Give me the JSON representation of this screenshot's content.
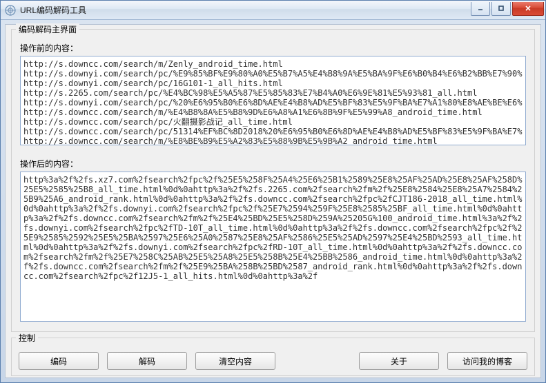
{
  "window": {
    "title": "URL编码解码工具"
  },
  "main_group": {
    "legend": "编码解码主界面",
    "before_label": "操作前的内容：",
    "after_label": "操作后的内容：",
    "before_text": "http://s.downcc.com/search/m/Zenly_android_time.html\nhttp://s.downyi.com/search/pc/%E9%85%BF%E9%80%A0%E5%B7%A5%E4%B8%9A%E5%BA%9F%E6%B0%B4%E6%B2%BB%E7%90% ...\nhttp://s.downyi.com/search/pc/16G101-1_all_hits.html\nhttp://s.2265.com/search/pc/%E4%BC%98%E5%A5%87%E5%85%83%E7%B4%A0%E6%9E%81%E5%93%81_all.html\nhttp://s.downyi.com/search/pc/%20%E6%95%B0%E6%8D%AE%E4%B8%AD%E5%BF%83%E5%9F%BA%E7%A1%80%E8%AE%BE%E6% ...\nhttp://s.downcc.com/search/m/%E4%B8%8A%E5%B8%9D%E6%A8%A1%E6%8B%9F%E5%99%A8_android_time.html\nhttp://s.downcc.com/search/pc/火翻摄影战记_all_time.html\nhttp://s.downcc.com/search/pc/51314%EF%BC%8D2018%20%E6%95%B0%E6%8D%AE%E4%B8%AD%E5%BF%83%E5%9F%BA%E7% ...\nhttp://s.downcc.com/search/m/%E8%BE%B9%E5%A2%83%E5%88%9B%E5%9B%A2_android_time.html",
    "after_text": "http%3a%2f%2fs.xz7.com%2fsearch%2fpc%2f%25E5%258F%25A4%25E6%25B1%2589%25E8%25AF%25AD%25E8%25AF%258D%25E5%2585%25B8_all_time.html%0d%0ahttp%3a%2f%2fs.2265.com%2fsearch%2fm%2f%25E8%2584%25E8%25A7%2584%25B9%25A6_android_rank.html%0d%0ahttp%3a%2f%2fs.downcc.com%2fsearch%2fpc%2fCJT186-2018_all_time.html%0d%0ahttp%3a%2f%2fs.downyi.com%2fsearch%2fpc%2f%25E7%2594%259F%25E8%2585%25BF_all_time.html%0d%0ahttp%3a%2f%2fs.downcc.com%2fsearch%2fm%2f%25E4%25BD%25E5%258D%259A%25205G%100_android_time.html%3a%2f%2fs.downyi.com%2fsearch%2fpc%2fTD-10T_all_time.html%0d%0ahttp%3a%2f%2fs.downcc.com%2fsearch%2fpc%2f%25E9%2585%2592%25E5%25BA%2597%25E6%25A0%2587%25E8%25AF%2586%25E5%25AD%2597%25E4%25BD%2593_all_time.html%0d%0ahttp%3a%2f%2fs.downyi.com%2fsearch%2fpc%2fRD-10T_all_time.html%0d%0ahttp%3a%2f%2fs.downcc.com%2fsearch%2fm%2f%25E7%258C%25AB%25E5%25A8%25E5%258B%25E4%25BB%2586_android_time.html%0d%0ahttp%3a%2f%2fs.downcc.com%2fsearch%2fm%2f%25E9%25BA%258B%25BD%2587_android_rank.html%0d%0ahttp%3a%2f%2fs.downcc.com%2fsearch%2fpc%2f12J5-1_all_hits.html%0d%0ahttp%3a%2f"
  },
  "control_group": {
    "legend": "控制",
    "buttons": {
      "encode": "编码",
      "decode": "解码",
      "clear": "清空内容",
      "about": "关于",
      "blog": "访问我的博客"
    }
  }
}
